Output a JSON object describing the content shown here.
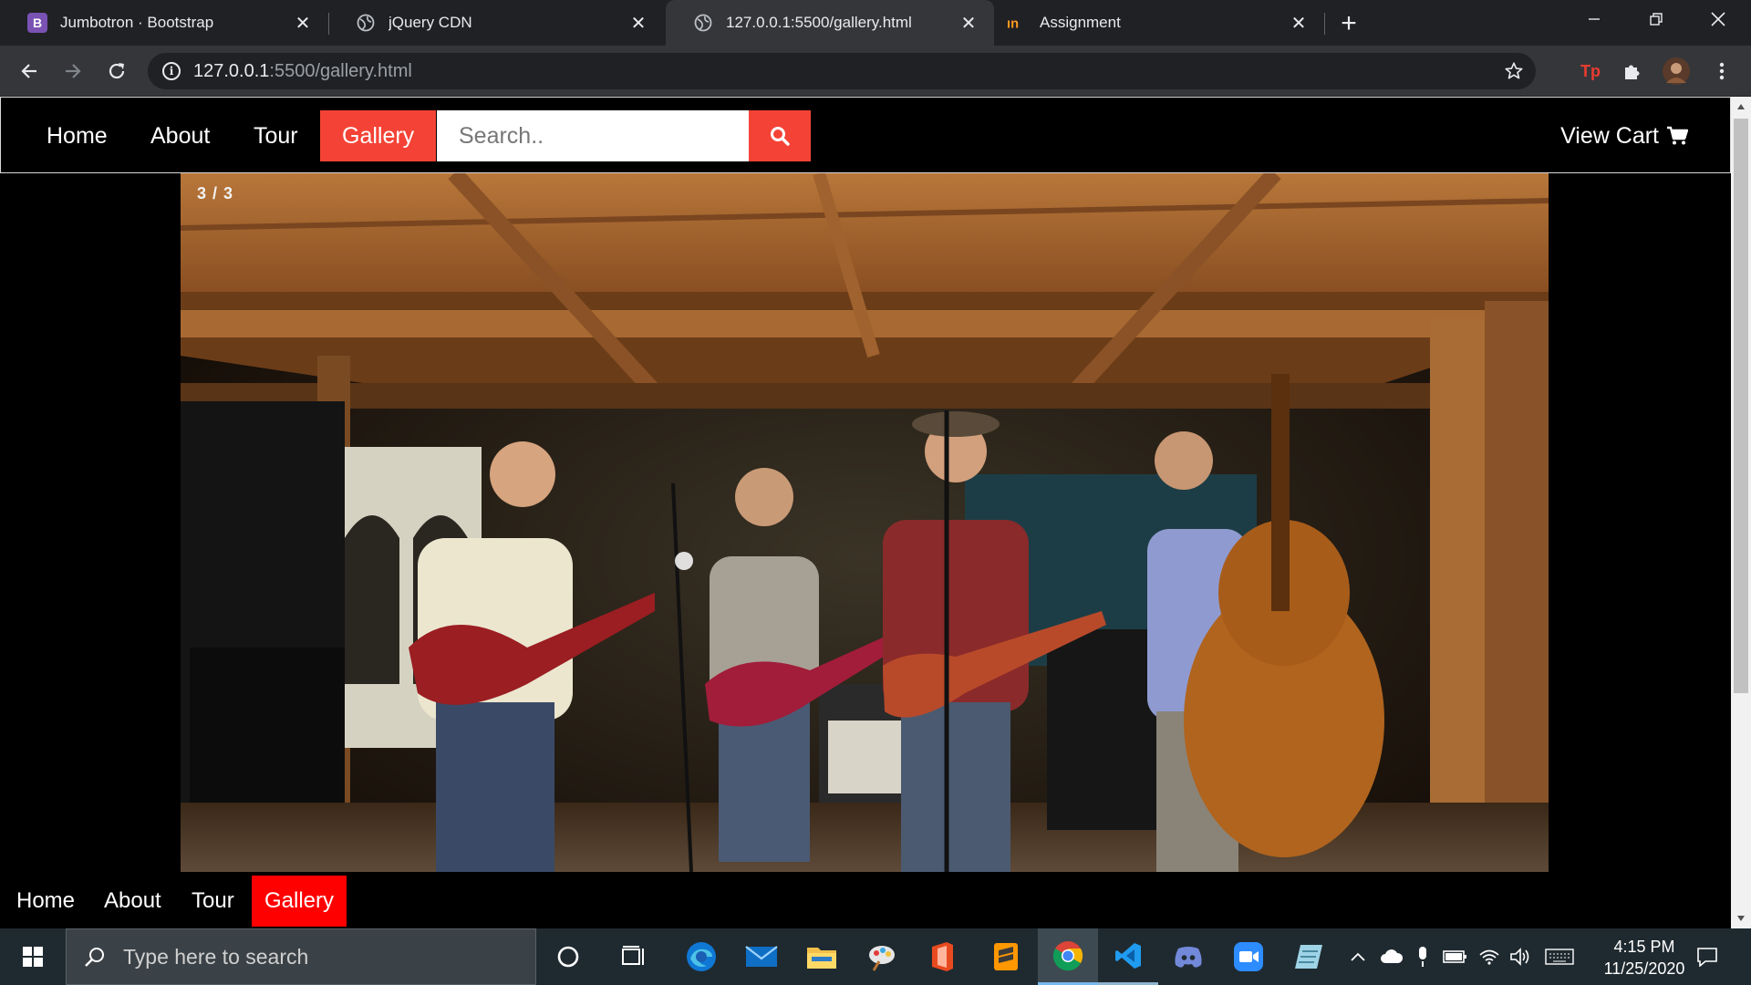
{
  "browser": {
    "tabs": [
      {
        "title": "Jumbotron · Bootstrap",
        "favicon": "bootstrap-icon",
        "active": false
      },
      {
        "title": "jQuery CDN",
        "favicon": "globe-icon",
        "active": false
      },
      {
        "title": "127.0.0.1:5500/gallery.html",
        "favicon": "globe-icon",
        "active": true
      },
      {
        "title": "Assignment",
        "favicon": "in-logo-icon",
        "active": false
      }
    ],
    "url_host": "127.0.0.1",
    "url_rest": ":5500/gallery.html"
  },
  "site": {
    "nav": {
      "home": "Home",
      "about": "About",
      "tour": "Tour",
      "gallery": "Gallery",
      "active": "Gallery"
    },
    "search_placeholder": "Search..",
    "view_cart": "View Cart",
    "slide_counter": "3 / 3",
    "slide_alt": "band playing on wooden stage",
    "bottom_nav": {
      "home": "Home",
      "about": "About",
      "tour": "Tour",
      "gallery": "Gallery"
    },
    "accent_color": "#f44336"
  },
  "taskbar": {
    "search_placeholder": "Type here to search",
    "time": "4:15 PM",
    "date": "11/25/2020",
    "apps": [
      "cortana-icon",
      "task-view-icon",
      "edge-icon",
      "mail-icon",
      "file-explorer-icon",
      "paint-icon",
      "office-icon",
      "sublime-icon",
      "chrome-icon",
      "vscode-icon",
      "discord-icon",
      "zoom-icon",
      "notepad-icon"
    ]
  }
}
